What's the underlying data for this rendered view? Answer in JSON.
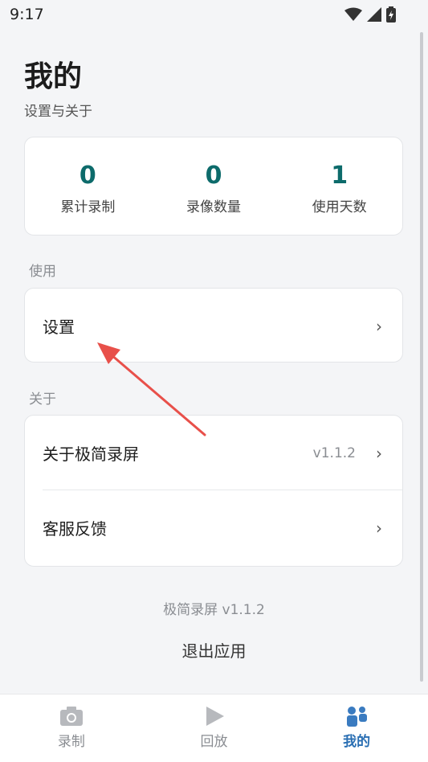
{
  "status_bar": {
    "time": "9:17"
  },
  "header": {
    "title": "我的",
    "subtitle": "设置与关于"
  },
  "stats": [
    {
      "value": "0",
      "label": "累计录制"
    },
    {
      "value": "0",
      "label": "录像数量"
    },
    {
      "value": "1",
      "label": "使用天数"
    }
  ],
  "sections": {
    "usage": {
      "label": "使用",
      "items": [
        {
          "label": "设置"
        }
      ]
    },
    "about": {
      "label": "关于",
      "items": [
        {
          "label": "关于极简录屏",
          "value": "v1.1.2"
        },
        {
          "label": "客服反馈"
        }
      ]
    }
  },
  "footer": {
    "version_text": "极简录屏 v1.1.2",
    "logout_label": "退出应用"
  },
  "tabbar": {
    "items": [
      {
        "label": "录制",
        "icon": "camera-icon"
      },
      {
        "label": "回放",
        "icon": "play-icon"
      },
      {
        "label": "我的",
        "icon": "profile-icon",
        "active": true
      }
    ]
  },
  "colors": {
    "accent": "#0d6b6b",
    "tab_active": "#2a6fb3",
    "annotation_arrow": "#e8504a"
  }
}
